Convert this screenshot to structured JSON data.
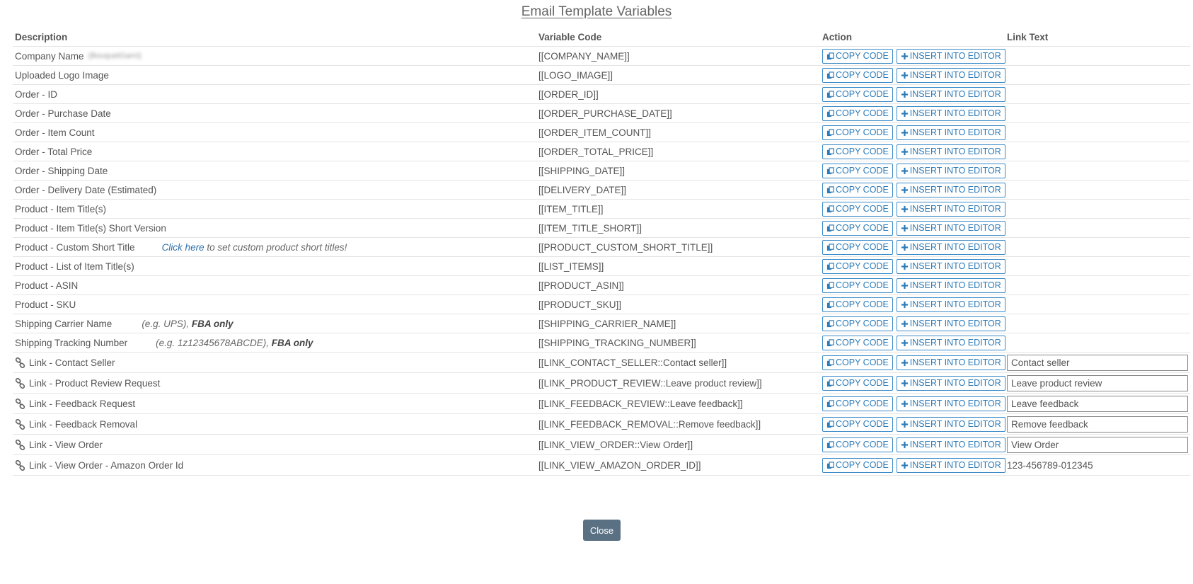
{
  "title": "Email Template Variables",
  "headers": {
    "description": "Description",
    "code": "Variable Code",
    "action": "Action",
    "link_text": "Link Text"
  },
  "buttons": {
    "copy": "COPY CODE",
    "insert": "INSERT INTO EDITOR",
    "close": "Close"
  },
  "rows": [
    {
      "desc": "Company Name",
      "code": "[[COMPANY_NAME]]",
      "blurred": "(BouquetGarni)"
    },
    {
      "desc": "Uploaded Logo Image",
      "code": "[[LOGO_IMAGE]]"
    },
    {
      "desc": "Order - ID",
      "code": "[[ORDER_ID]]"
    },
    {
      "desc": "Order - Purchase Date",
      "code": "[[ORDER_PURCHASE_DATE]]"
    },
    {
      "desc": "Order - Item Count",
      "code": "[[ORDER_ITEM_COUNT]]"
    },
    {
      "desc": "Order - Total Price",
      "code": "[[ORDER_TOTAL_PRICE]]"
    },
    {
      "desc": "Order - Shipping Date",
      "code": "[[SHIPPING_DATE]]"
    },
    {
      "desc": "Order - Delivery Date (Estimated)",
      "code": "[[DELIVERY_DATE]]"
    },
    {
      "desc": "Product - Item Title(s)",
      "code": "[[ITEM_TITLE]]"
    },
    {
      "desc": "Product - Item Title(s) Short Version",
      "code": "[[ITEM_TITLE_SHORT]]"
    },
    {
      "desc": "Product - Custom Short Title",
      "code": "[[PRODUCT_CUSTOM_SHORT_TITLE]]",
      "hint_link": "Click here",
      "hint_text": " to set custom product short titles!"
    },
    {
      "desc": "Product - List of Item Title(s)",
      "code": "[[LIST_ITEMS]]"
    },
    {
      "desc": "Product - ASIN",
      "code": "[[PRODUCT_ASIN]]"
    },
    {
      "desc": "Product - SKU",
      "code": "[[PRODUCT_SKU]]"
    },
    {
      "desc": "Shipping Carrier Name",
      "code": "[[SHIPPING_CARRIER_NAME]]",
      "hint_text": "(e.g. UPS), ",
      "hint_bold": "FBA only"
    },
    {
      "desc": "Shipping Tracking Number",
      "code": "[[SHIPPING_TRACKING_NUMBER]]",
      "hint_text": "(e.g. 1z12345678ABCDE), ",
      "hint_bold": "FBA only"
    },
    {
      "desc": "Link - Contact Seller",
      "code": "[[LINK_CONTACT_SELLER::Contact seller]]",
      "link": true,
      "link_value": "Contact seller"
    },
    {
      "desc": "Link - Product Review Request",
      "code": "[[LINK_PRODUCT_REVIEW::Leave product review]]",
      "link": true,
      "link_value": "Leave product review"
    },
    {
      "desc": "Link - Feedback Request",
      "code": "[[LINK_FEEDBACK_REVIEW::Leave feedback]]",
      "link": true,
      "link_value": "Leave feedback"
    },
    {
      "desc": "Link - Feedback Removal",
      "code": "[[LINK_FEEDBACK_REMOVAL::Remove feedback]]",
      "link": true,
      "link_value": "Remove feedback"
    },
    {
      "desc": "Link - View Order",
      "code": "[[LINK_VIEW_ORDER::View Order]]",
      "link": true,
      "link_value": "View Order"
    },
    {
      "desc": "Link - View Order - Amazon Order Id",
      "code": "[[LINK_VIEW_AMAZON_ORDER_ID]]",
      "link": true,
      "link_static": "123-456789-012345"
    }
  ]
}
